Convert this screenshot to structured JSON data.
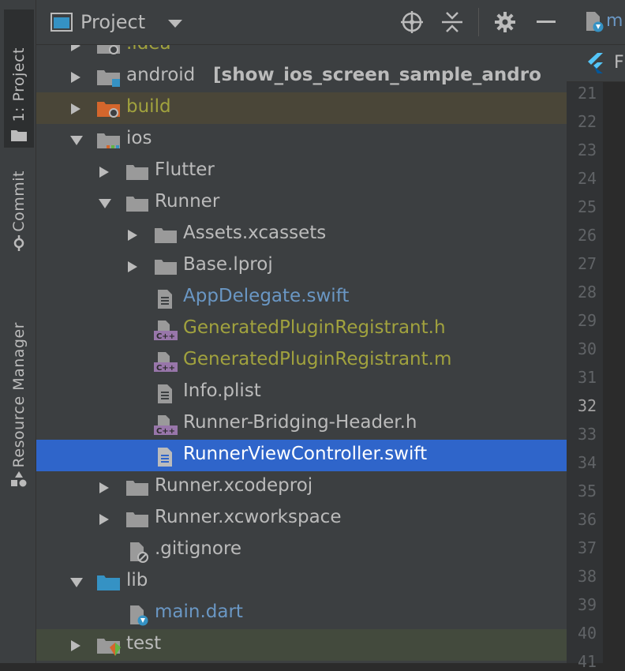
{
  "sidebar": {
    "tabs": [
      {
        "label": "1: Project",
        "icon": "folder-icon",
        "active": true
      },
      {
        "label": "Commit",
        "icon": "commit-icon",
        "active": false
      },
      {
        "label": "Resource Manager",
        "icon": "shapes-icon",
        "active": false
      }
    ]
  },
  "header": {
    "title": "Project",
    "icons": [
      "dropdown-icon",
      "locate-icon",
      "collapse-icon",
      "gear-icon",
      "minimize-icon"
    ]
  },
  "tree": [
    {
      "label": ".idea",
      "style": "olive",
      "icon": "folder-settings-icon"
    },
    {
      "label": "android",
      "suffix": "[show_ios_screen_sample_andro",
      "icon": "module-folder-icon"
    },
    {
      "label": "build",
      "style": "olive",
      "icon": "build-folder-icon"
    },
    {
      "label": "ios",
      "icon": "module-folder-icon"
    },
    {
      "label": "Flutter",
      "icon": "folder-icon"
    },
    {
      "label": "Runner",
      "icon": "folder-icon"
    },
    {
      "label": "Assets.xcassets",
      "icon": "folder-icon"
    },
    {
      "label": "Base.lproj",
      "icon": "folder-icon"
    },
    {
      "label": "AppDelegate.swift",
      "style": "blue",
      "icon": "file-icon"
    },
    {
      "label": "GeneratedPluginRegistrant.h",
      "style": "olive",
      "icon": "cpp-file-icon"
    },
    {
      "label": "GeneratedPluginRegistrant.m",
      "style": "olive",
      "icon": "cpp-file-icon"
    },
    {
      "label": "Info.plist",
      "icon": "file-icon"
    },
    {
      "label": "Runner-Bridging-Header.h",
      "icon": "cpp-file-icon"
    },
    {
      "label": "RunnerViewController.swift",
      "style": "selected",
      "icon": "file-icon"
    },
    {
      "label": "Runner.xcodeproj",
      "icon": "folder-icon"
    },
    {
      "label": "Runner.xcworkspace",
      "icon": "folder-icon"
    },
    {
      "label": ".gitignore",
      "icon": "ignored-file-icon"
    },
    {
      "label": "lib",
      "icon": "source-folder-icon"
    },
    {
      "label": "main.dart",
      "style": "blue",
      "icon": "dart-file-icon"
    },
    {
      "label": "test",
      "icon": "test-folder-icon"
    }
  ],
  "editor": {
    "tab_label": "m",
    "tab2_label": "F",
    "line_numbers": [
      "21",
      "22",
      "23",
      "24",
      "25",
      "26",
      "27",
      "28",
      "29",
      "30",
      "31",
      "32",
      "33",
      "34",
      "35",
      "36",
      "37",
      "38",
      "39",
      "40",
      "41"
    ],
    "current_line": "32"
  },
  "colors": {
    "selection": "#2f65ca",
    "olive_text": "#a1a23e",
    "blue_text": "#6a97c4",
    "panel_bg": "#3c3f41"
  }
}
